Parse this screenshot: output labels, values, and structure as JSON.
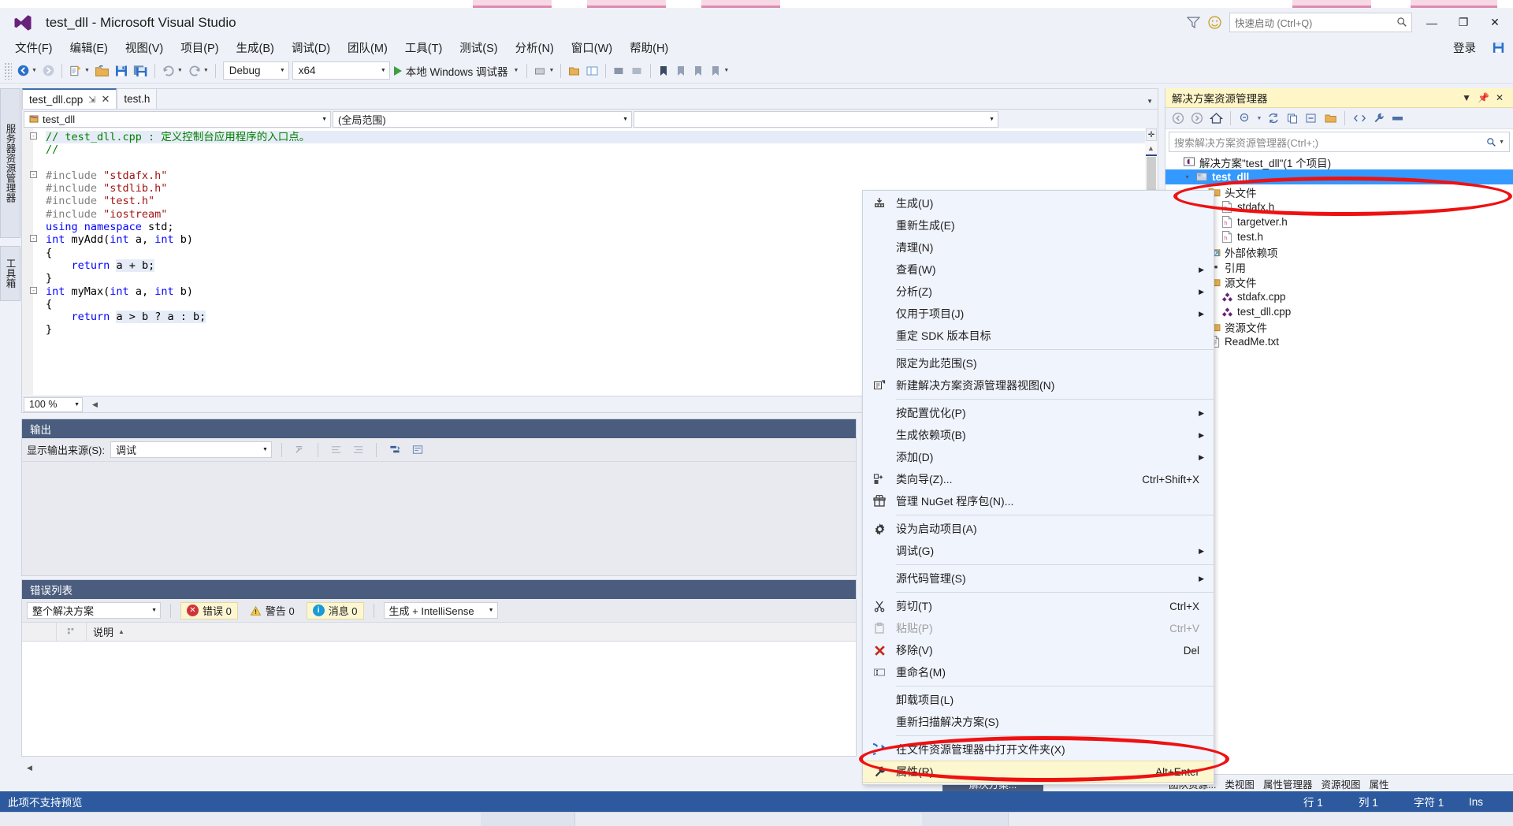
{
  "window": {
    "title": "test_dll - Microsoft Visual Studio",
    "quick_launch_placeholder": "快速启动 (Ctrl+Q)",
    "sign_in": "登录",
    "minimize": "—",
    "maximize": "❐",
    "close": "✕"
  },
  "menubar": {
    "items": [
      {
        "label": "文件(F)"
      },
      {
        "label": "编辑(E)"
      },
      {
        "label": "视图(V)"
      },
      {
        "label": "项目(P)"
      },
      {
        "label": "生成(B)"
      },
      {
        "label": "调试(D)"
      },
      {
        "label": "团队(M)"
      },
      {
        "label": "工具(T)"
      },
      {
        "label": "测试(S)"
      },
      {
        "label": "分析(N)"
      },
      {
        "label": "窗口(W)"
      },
      {
        "label": "帮助(H)"
      }
    ]
  },
  "toolbar": {
    "config": "Debug",
    "platform": "x64",
    "run_label": "本地 Windows 调试器"
  },
  "left_strip": {
    "tabs": [
      {
        "label": "服务器资源管理器"
      },
      {
        "label": "工具箱"
      }
    ]
  },
  "editor": {
    "tabs": [
      {
        "label": "test_dll.cpp",
        "active": true
      },
      {
        "label": "test.h",
        "active": false
      }
    ],
    "nav_scope": "test_dll",
    "nav_member": "(全局范围)",
    "nav_third": "",
    "zoom": "100 %",
    "lines": [
      {
        "text": "// test_dll.cpp : 定义控制台应用程序的入口点。",
        "kind": "comment",
        "fold": "-",
        "highlight": true
      },
      {
        "text": "//",
        "kind": "comment"
      },
      {
        "text": "",
        "kind": "plain"
      },
      {
        "text": "#include \"stdafx.h\"",
        "kind": "include",
        "fold": "-"
      },
      {
        "text": "#include \"stdlib.h\"",
        "kind": "include"
      },
      {
        "text": "#include \"test.h\"",
        "kind": "include"
      },
      {
        "text": "#include \"iostream\"",
        "kind": "include"
      },
      {
        "text": "using namespace std;",
        "kind": "using"
      },
      {
        "text": "int myAdd(int a, int b)",
        "kind": "func",
        "fold": "-"
      },
      {
        "text": "{",
        "kind": "plain"
      },
      {
        "text": "    return a + b;",
        "kind": "ret"
      },
      {
        "text": "}",
        "kind": "plain"
      },
      {
        "text": "int myMax(int a, int b)",
        "kind": "func2",
        "fold": "-"
      },
      {
        "text": "{",
        "kind": "plain"
      },
      {
        "text": "    return a > b ? a : b;",
        "kind": "ret2"
      },
      {
        "text": "}",
        "kind": "plain"
      }
    ]
  },
  "output_pane": {
    "title": "输出",
    "source_label": "显示输出来源(S):",
    "source_value": "调试"
  },
  "error_pane": {
    "title": "错误列表",
    "scope": "整个解决方案",
    "errors": "错误 0",
    "warnings": "警告 0",
    "messages": "消息 0",
    "build_filter": "生成 + IntelliSense",
    "column_description": "说明"
  },
  "solution_explorer": {
    "title": "解决方案资源管理器",
    "search_placeholder": "搜索解决方案资源管理器(Ctrl+;)",
    "tree": [
      {
        "label": "解决方案\"test_dll\"(1 个项目)",
        "indent": 0,
        "icon": "solution-icon",
        "twisty": "",
        "selected": false
      },
      {
        "label": "test_dll",
        "indent": 1,
        "icon": "project-icon",
        "twisty": "▾",
        "selected": true
      },
      {
        "label": "头文件",
        "indent": 2,
        "icon": "folder-icon",
        "twisty": "▾",
        "selected": false
      },
      {
        "label": "stdafx.h",
        "indent": 3,
        "icon": "h-file-icon",
        "twisty": "",
        "selected": false
      },
      {
        "label": "targetver.h",
        "indent": 3,
        "icon": "h-file-icon",
        "twisty": "",
        "selected": false
      },
      {
        "label": "test.h",
        "indent": 3,
        "icon": "h-file-icon",
        "twisty": "",
        "selected": false
      },
      {
        "label": "外部依赖项",
        "indent": 2,
        "icon": "ext-folder-icon",
        "twisty": "▸",
        "selected": false
      },
      {
        "label": "引用",
        "indent": 2,
        "icon": "reference-icon",
        "twisty": "▸",
        "selected": false
      },
      {
        "label": "源文件",
        "indent": 2,
        "icon": "folder-icon",
        "twisty": "▾",
        "selected": false
      },
      {
        "label": "stdafx.cpp",
        "indent": 3,
        "icon": "cpp-file-icon",
        "twisty": "",
        "selected": false
      },
      {
        "label": "test_dll.cpp",
        "indent": 3,
        "icon": "cpp-file-icon",
        "twisty": "",
        "selected": false
      },
      {
        "label": "资源文件",
        "indent": 2,
        "icon": "folder-icon",
        "twisty": "▸",
        "selected": false
      },
      {
        "label": "ReadMe.txt",
        "indent": 2,
        "icon": "txt-file-icon",
        "twisty": "",
        "selected": false
      }
    ]
  },
  "context_menu": {
    "items": [
      {
        "label": "生成(U)",
        "icon": "build-icon",
        "key": "",
        "sub": false,
        "sep_after": false,
        "disabled": false,
        "highlight": false
      },
      {
        "label": "重新生成(E)",
        "icon": "",
        "key": "",
        "sub": false,
        "sep_after": false,
        "disabled": false,
        "highlight": false
      },
      {
        "label": "清理(N)",
        "icon": "",
        "key": "",
        "sub": false,
        "sep_after": false,
        "disabled": false,
        "highlight": false
      },
      {
        "label": "查看(W)",
        "icon": "",
        "key": "",
        "sub": true,
        "sep_after": false,
        "disabled": false,
        "highlight": false
      },
      {
        "label": "分析(Z)",
        "icon": "",
        "key": "",
        "sub": true,
        "sep_after": false,
        "disabled": false,
        "highlight": false
      },
      {
        "label": "仅用于项目(J)",
        "icon": "",
        "key": "",
        "sub": true,
        "sep_after": false,
        "disabled": false,
        "highlight": false
      },
      {
        "label": "重定 SDK 版本目标",
        "icon": "",
        "key": "",
        "sub": false,
        "sep_after": true,
        "disabled": false,
        "highlight": false
      },
      {
        "label": "限定为此范围(S)",
        "icon": "",
        "key": "",
        "sub": false,
        "sep_after": false,
        "disabled": false,
        "highlight": false
      },
      {
        "label": "新建解决方案资源管理器视图(N)",
        "icon": "new-view-icon",
        "key": "",
        "sub": false,
        "sep_after": true,
        "disabled": false,
        "highlight": false
      },
      {
        "label": "按配置优化(P)",
        "icon": "",
        "key": "",
        "sub": true,
        "sep_after": false,
        "disabled": false,
        "highlight": false
      },
      {
        "label": "生成依赖项(B)",
        "icon": "",
        "key": "",
        "sub": true,
        "sep_after": false,
        "disabled": false,
        "highlight": false
      },
      {
        "label": "添加(D)",
        "icon": "",
        "key": "",
        "sub": true,
        "sep_after": false,
        "disabled": false,
        "highlight": false
      },
      {
        "label": "类向导(Z)...",
        "icon": "class-wizard-icon",
        "key": "Ctrl+Shift+X",
        "sub": false,
        "sep_after": false,
        "disabled": false,
        "highlight": false
      },
      {
        "label": "管理 NuGet 程序包(N)...",
        "icon": "nuget-icon",
        "key": "",
        "sub": false,
        "sep_after": true,
        "disabled": false,
        "highlight": false
      },
      {
        "label": "设为启动项目(A)",
        "icon": "gear-icon",
        "key": "",
        "sub": false,
        "sep_after": false,
        "disabled": false,
        "highlight": false
      },
      {
        "label": "调试(G)",
        "icon": "",
        "key": "",
        "sub": true,
        "sep_after": true,
        "disabled": false,
        "highlight": false
      },
      {
        "label": "源代码管理(S)",
        "icon": "",
        "key": "",
        "sub": true,
        "sep_after": true,
        "disabled": false,
        "highlight": false
      },
      {
        "label": "剪切(T)",
        "icon": "cut-icon",
        "key": "Ctrl+X",
        "sub": false,
        "sep_after": false,
        "disabled": false,
        "highlight": false
      },
      {
        "label": "粘贴(P)",
        "icon": "paste-icon",
        "key": "Ctrl+V",
        "sub": false,
        "sep_after": false,
        "disabled": true,
        "highlight": false
      },
      {
        "label": "移除(V)",
        "icon": "remove-icon",
        "key": "Del",
        "sub": false,
        "sep_after": false,
        "disabled": false,
        "highlight": false
      },
      {
        "label": "重命名(M)",
        "icon": "rename-icon",
        "key": "",
        "sub": false,
        "sep_after": true,
        "disabled": false,
        "highlight": false
      },
      {
        "label": "卸载项目(L)",
        "icon": "",
        "key": "",
        "sub": false,
        "sep_after": false,
        "disabled": false,
        "highlight": false
      },
      {
        "label": "重新扫描解决方案(S)",
        "icon": "",
        "key": "",
        "sub": false,
        "sep_after": true,
        "disabled": false,
        "highlight": false
      },
      {
        "label": "在文件资源管理器中打开文件夹(X)",
        "icon": "open-folder-icon",
        "key": "",
        "sub": false,
        "sep_after": false,
        "disabled": false,
        "highlight": false
      },
      {
        "label": "属性(R)",
        "icon": "wrench-icon",
        "key": "Alt+Enter",
        "sub": false,
        "sep_after": false,
        "disabled": false,
        "highlight": true
      }
    ]
  },
  "dock_tabs": {
    "solution_tab": "解决方案...",
    "items": [
      {
        "label": "团队资源...",
        "active": false
      },
      {
        "label": "类视图",
        "active": false
      },
      {
        "label": "属性管理器",
        "active": false
      },
      {
        "label": "资源视图",
        "active": false
      },
      {
        "label": "属性",
        "active": false
      }
    ]
  },
  "statusbar": {
    "message": "此项不支持预览",
    "line": "行 1",
    "column": "列 1",
    "character": "字符 1",
    "insert": "Ins"
  },
  "colors": {
    "accent": "#2d5a9e",
    "selection": "#3399ff",
    "highlight": "#fdf7cf",
    "annotation": "#ee1111",
    "panel_title": "#4a5d7e"
  }
}
